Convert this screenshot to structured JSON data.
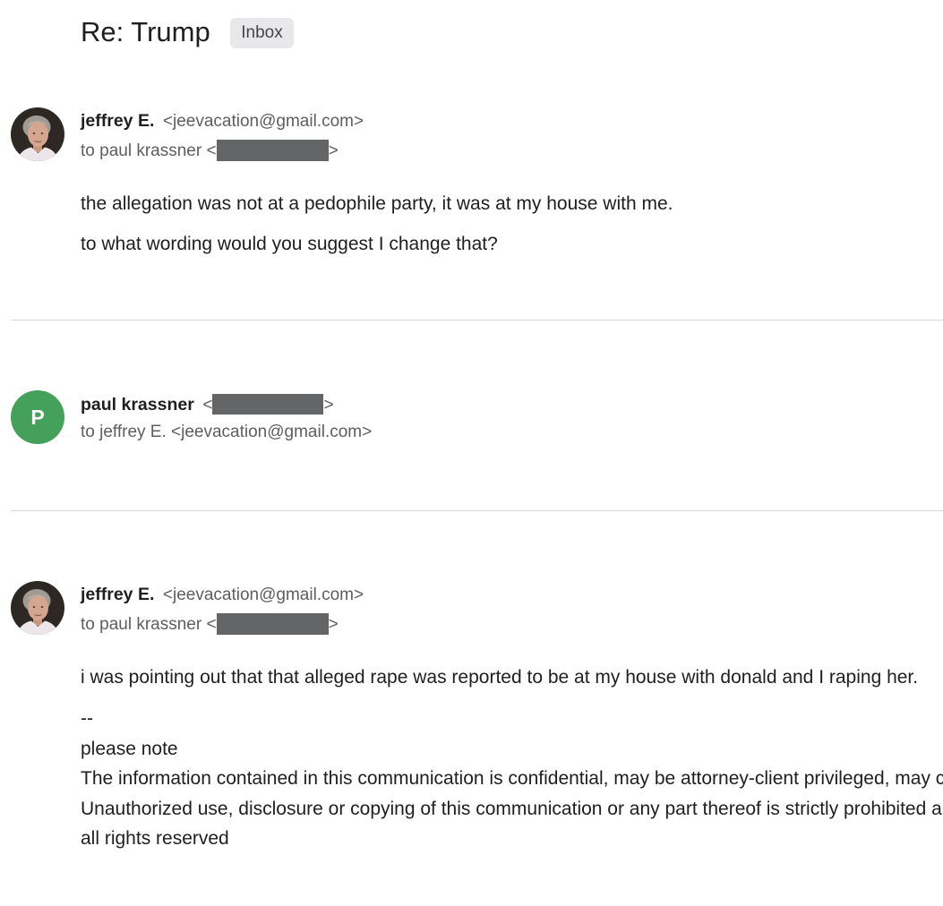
{
  "subject": {
    "title": "Re: Trump",
    "label": "Inbox"
  },
  "messages": [
    {
      "sender_name": "jeffrey E.",
      "sender_email": "<jeevacation@gmail.com>",
      "avatar_icon": "person-photo-icon",
      "to_prefix": "to paul krassner <",
      "to_suffix": ">",
      "body": [
        "the allegation was not at a pedophile party, it was at my house with me.",
        "to what wording would you suggest I change that?"
      ]
    },
    {
      "sender_name": "paul krassner",
      "sender_email_open": "<",
      "sender_email_close": ">",
      "avatar_letter": "P",
      "to_line": "to jeffrey E. <jeevacation@gmail.com>"
    },
    {
      "sender_name": "jeffrey E.",
      "sender_email": "<jeevacation@gmail.com>",
      "avatar_icon": "person-photo-icon",
      "to_prefix": "to paul krassner <",
      "to_suffix": ">",
      "body": [
        "i was pointing out that that alleged rape was reported to be at my house with donald and I raping her."
      ],
      "signature": [
        "--",
        "please note",
        "The information contained in this communication is confidential, may be attorney-client privileged, may c",
        "Unauthorized use, disclosure or copying of this communication or any part thereof is strictly prohibited a",
        "all rights reserved"
      ]
    }
  ],
  "colors": {
    "primary_text": "#1f1f1f",
    "secondary_text": "#5e5e5e",
    "label_chip_background": "#e8e8ea",
    "label_chip_text": "#444746",
    "redaction": "#646566",
    "divider": "#dadce0",
    "letter_avatar_background": "#45a05a",
    "letter_avatar_text": "#ffffff"
  }
}
